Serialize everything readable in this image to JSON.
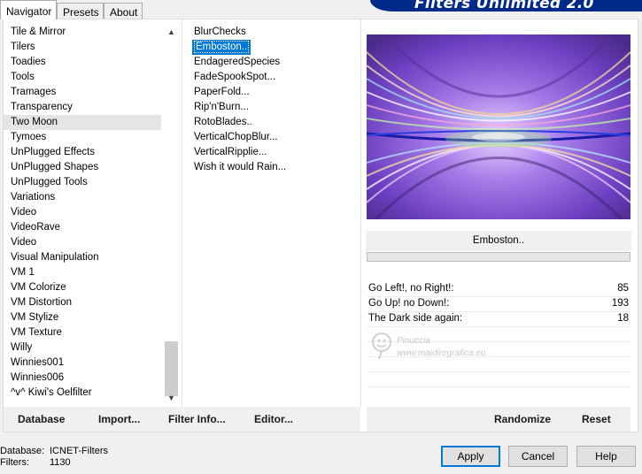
{
  "tabs": [
    "Navigator",
    "Presets",
    "About"
  ],
  "banner_title": "Filters Unlimited 2.0",
  "categories": [
    "Tile & Mirror",
    "Tilers",
    "Toadies",
    "Tools",
    "Tramages",
    "Transparency",
    "Two Moon",
    "Tymoes",
    "UnPlugged Effects",
    "UnPlugged Shapes",
    "UnPlugged Tools",
    "Variations",
    "Video",
    "VideoRave",
    "Video",
    "Visual Manipulation",
    "VM 1",
    "VM Colorize",
    "VM Distortion",
    "VM Stylize",
    "VM Texture",
    "Willy",
    "Winnies001",
    "Winnies006",
    "^v^ Kiwi's Oelfilter"
  ],
  "selected_category": "Two Moon",
  "filters": [
    "BlurChecks",
    "Emboston..",
    "EndageredSpecies",
    "FadeSpookSpot...",
    "PaperFold...",
    "Rip'n'Burn...",
    "RotoBlades..",
    "VerticalChopBlur...",
    "VerticalRipplie...",
    "Wish it would Rain..."
  ],
  "selected_filter": "Emboston..",
  "filter_name": "Emboston..",
  "params": [
    {
      "label": "Go Left!, no Right!:",
      "value": "85"
    },
    {
      "label": "Go Up! no Down!:",
      "value": "193"
    },
    {
      "label": "The Dark side again:",
      "value": "18"
    }
  ],
  "watermark": {
    "line1": "Pinuccia",
    "line2": "www.maidiregrafica.eu"
  },
  "strip_buttons": {
    "database": "Database",
    "import": "Import...",
    "filter_info": "Filter Info...",
    "editor": "Editor...",
    "randomize": "Randomize",
    "reset": "Reset"
  },
  "footer": {
    "database_label": "Database:",
    "database_value": "ICNET-Filters",
    "filters_label": "Filters:",
    "filters_value": "1130"
  },
  "buttons": {
    "apply": "Apply",
    "cancel": "Cancel",
    "help": "Help"
  },
  "colors": {
    "selection": "#0078d7",
    "banner": "#002a8a",
    "accent_default": "#0078d7"
  }
}
